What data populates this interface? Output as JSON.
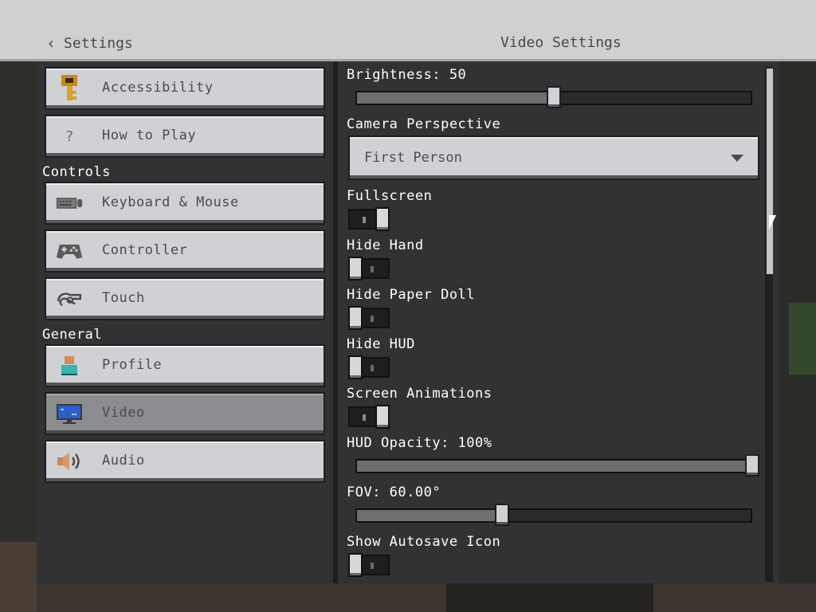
{
  "header": {
    "back_label": "Settings",
    "title": "Video Settings"
  },
  "sidebar": {
    "items_top": [
      {
        "label": "Accessibility",
        "icon": "key-icon"
      },
      {
        "label": "How to Play",
        "icon": "question-icon"
      }
    ],
    "controls_label": "Controls",
    "controls_items": [
      {
        "label": "Keyboard & Mouse",
        "icon": "keyboard-icon"
      },
      {
        "label": "Controller",
        "icon": "gamepad-icon"
      },
      {
        "label": "Touch",
        "icon": "touch-icon"
      }
    ],
    "general_label": "General",
    "general_items": [
      {
        "label": "Profile",
        "icon": "profile-icon"
      },
      {
        "label": "Video",
        "icon": "monitor-icon",
        "selected": true
      },
      {
        "label": "Audio",
        "icon": "speaker-icon"
      }
    ]
  },
  "settings": {
    "brightness": {
      "label": "Brightness: 50",
      "value": 0.5
    },
    "camera_perspective": {
      "label": "Camera Perspective",
      "value": "First Person"
    },
    "fullscreen": {
      "label": "Fullscreen",
      "on": true
    },
    "hide_hand": {
      "label": "Hide Hand",
      "on": false
    },
    "hide_paper_doll": {
      "label": "Hide Paper Doll",
      "on": false
    },
    "hide_hud": {
      "label": "Hide HUD",
      "on": false
    },
    "screen_animations": {
      "label": "Screen Animations",
      "on": true
    },
    "hud_opacity": {
      "label": "HUD Opacity: 100%",
      "value": 1.0
    },
    "fov": {
      "label": "FOV: 60.00°",
      "value": 0.37
    },
    "show_autosave_icon": {
      "label": "Show Autosave Icon",
      "on": false
    }
  },
  "colors": {
    "panel": "#313233",
    "button": "#d0d1d4",
    "button_selected": "#8c8d90",
    "header": "#d0d0d0"
  }
}
